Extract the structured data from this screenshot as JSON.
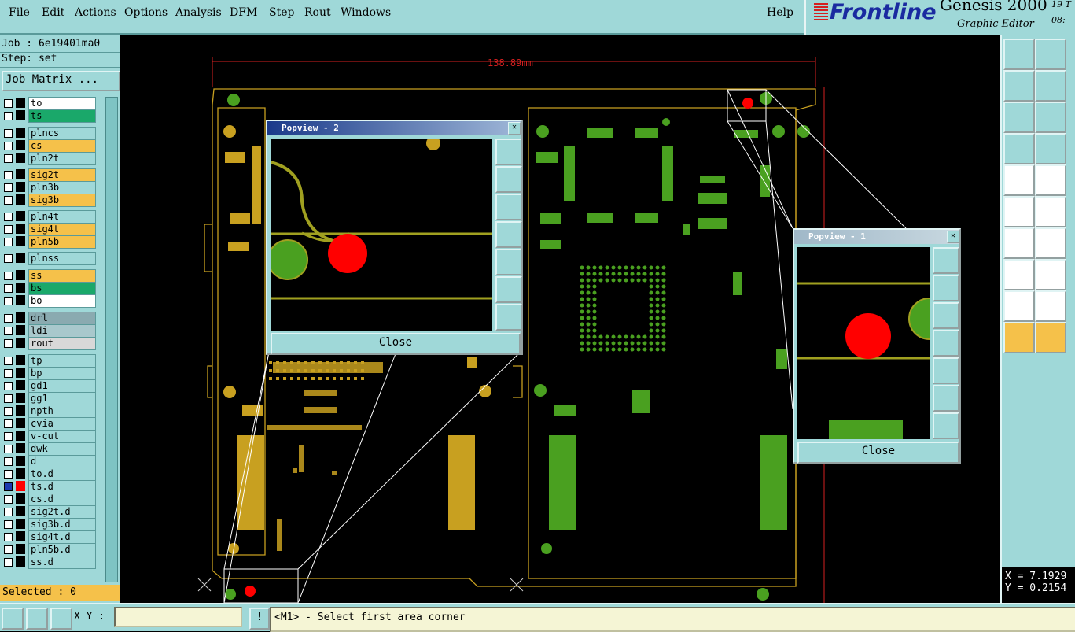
{
  "menu": {
    "file": "File",
    "edit": "Edit",
    "actions": "Actions",
    "options": "Options",
    "analysis": "Analysis",
    "dfm": "DFM",
    "step": "Step",
    "rout": "Rout",
    "windows": "Windows",
    "help": "Help"
  },
  "brand": {
    "logo": "Frontline",
    "product": "Genesis 2000",
    "subtitle": "Graphic Editor",
    "extra_top": "19 T",
    "extra_bottom": "08:"
  },
  "job": {
    "job_line": "Job : 6e19401ma0",
    "step_line": "Step: set",
    "matrix_button": "Job Matrix ..."
  },
  "layers": [
    {
      "name": "to",
      "color": "#ffffff"
    },
    {
      "name": "ts",
      "color": "#1aa86a"
    },
    {
      "name": "plncs",
      "color": "#9fd8d8"
    },
    {
      "name": "cs",
      "color": "#f5c14a"
    },
    {
      "name": "pln2t",
      "color": "#9fd8d8"
    },
    {
      "name": "sig2t",
      "color": "#f5c14a"
    },
    {
      "name": "pln3b",
      "color": "#9fd8d8"
    },
    {
      "name": "sig3b",
      "color": "#f5c14a"
    },
    {
      "name": "pln4t",
      "color": "#9fd8d8"
    },
    {
      "name": "sig4t",
      "color": "#f5c14a"
    },
    {
      "name": "pln5b",
      "color": "#f5c14a"
    },
    {
      "name": "plnss",
      "color": "#9fd8d8"
    },
    {
      "name": "ss",
      "color": "#f5c14a"
    },
    {
      "name": "bs",
      "color": "#1aa86a"
    },
    {
      "name": "bo",
      "color": "#ffffff"
    },
    {
      "name": "drl",
      "color": "#8aaab0"
    },
    {
      "name": "ldi",
      "color": "#a8c8cc"
    },
    {
      "name": "rout",
      "color": "#d8d8d8"
    },
    {
      "name": "tp",
      "color": "#9fd8d8"
    },
    {
      "name": "bp",
      "color": "#9fd8d8"
    },
    {
      "name": "gd1",
      "color": "#9fd8d8"
    },
    {
      "name": "gg1",
      "color": "#9fd8d8"
    },
    {
      "name": "npth",
      "color": "#9fd8d8"
    },
    {
      "name": "cvia",
      "color": "#9fd8d8"
    },
    {
      "name": "v-cut",
      "color": "#9fd8d8"
    },
    {
      "name": "dwk",
      "color": "#9fd8d8"
    },
    {
      "name": "d",
      "color": "#9fd8d8"
    },
    {
      "name": "to.d",
      "color": "#9fd8d8"
    },
    {
      "name": "ts.d",
      "color": "#9fd8d8"
    },
    {
      "name": "cs.d",
      "color": "#9fd8d8"
    },
    {
      "name": "sig2t.d",
      "color": "#9fd8d8"
    },
    {
      "name": "sig3b.d",
      "color": "#9fd8d8"
    },
    {
      "name": "sig4t.d",
      "color": "#9fd8d8"
    },
    {
      "name": "pln5b.d",
      "color": "#9fd8d8"
    },
    {
      "name": "ss.d",
      "color": "#9fd8d8"
    }
  ],
  "selected": "Selected : 0",
  "canvas": {
    "dimension_label": "138.89mm"
  },
  "popview2": {
    "title": "Popview - 2",
    "close": "Close"
  },
  "popview1": {
    "title": "Popview - 1",
    "close": "Close"
  },
  "bottom": {
    "xy_label": "X Y :",
    "xy_value": "",
    "bang": "!",
    "prompt": "<M1> - Select first area corner"
  },
  "coords": {
    "x": "X = 7.1929",
    "y": "Y = 0.2154"
  },
  "colors": {
    "panel": "#9fd8d8",
    "board_outline": "#c8a020",
    "copper_green": "#4aa020",
    "copper_gold": "#c8a020",
    "red_pad": "#ff0000"
  }
}
